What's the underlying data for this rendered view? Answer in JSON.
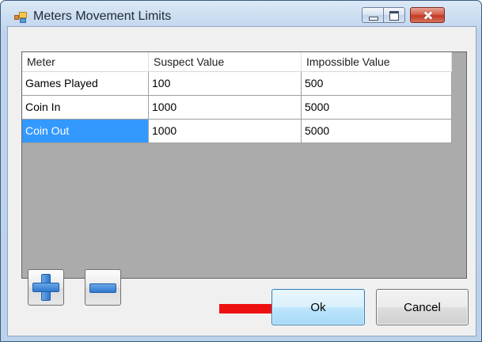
{
  "window": {
    "title": "Meters Movement Limits"
  },
  "grid": {
    "columns": [
      "Meter",
      "Suspect Value",
      "Impossible Value"
    ],
    "rows": [
      {
        "meter": "Games Played",
        "suspect": "100",
        "impossible": "500",
        "selected": false
      },
      {
        "meter": "Coin In",
        "suspect": "1000",
        "impossible": "5000",
        "selected": false
      },
      {
        "meter": "Coin Out",
        "suspect": "1000",
        "impossible": "5000",
        "selected": true
      }
    ],
    "selection_color": "#3399ff",
    "background_color": "#ababab"
  },
  "buttons": {
    "add_icon": "plus-icon",
    "remove_icon": "minus-icon",
    "ok_label": "Ok",
    "cancel_label": "Cancel"
  },
  "annotation": {
    "arrow_color": "#ee1111"
  }
}
